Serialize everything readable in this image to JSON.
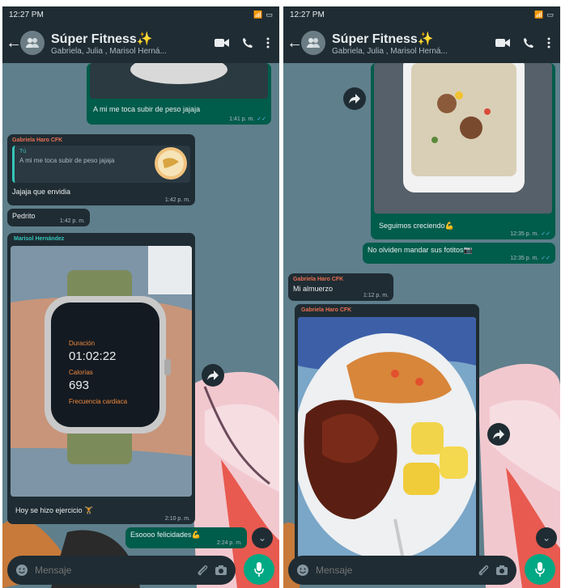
{
  "status_time": "12:27 PM",
  "chat": {
    "title": "Súper Fitness✨",
    "subtitle": "Gabriela, Julia , Marisol Herná..."
  },
  "left": {
    "msg_out_1": {
      "text": "A mi me toca subir de peso jajaja",
      "time": "1:41 p. m."
    },
    "reply_msg": {
      "sender": "Gabriela Haro CFK",
      "quoted_author": "Tú",
      "quoted_text": "A mi me toca subir de peso jajaja",
      "text": "Jajaja que envidia",
      "time": "1:42 p. m."
    },
    "msg_pedrito": {
      "text": "Pedrito",
      "time": "1:42 p. m."
    },
    "photo_msg": {
      "sender": "Marisol Hernández",
      "watch_duration_label": "Duración",
      "watch_duration": "01:02:22",
      "watch_calories_label": "Calorías",
      "watch_calories": "693",
      "watch_hr_label": "Frecuencia cardiaca",
      "caption": "Hoy se hizo ejercicio 🏋",
      "time": "2:10 p. m."
    },
    "msg_out_2": {
      "text": "Esoooo felicidades💪",
      "time": "2:24 p. m."
    }
  },
  "right": {
    "msg_out_1": {
      "text": "Seguimos creciendo💪",
      "time": "12:35 p. m."
    },
    "msg_out_2": {
      "text": "No olviden mandar sus fotitos📷",
      "time": "12:35 p. m."
    },
    "msg_in_1": {
      "sender": "Gabriela Haro CFK",
      "text": "Mi almuerzo",
      "time": "1:12 p. m."
    },
    "photo_msg": {
      "sender": "Gabriela Haro CFK"
    }
  },
  "composer": {
    "placeholder": "Mensaje"
  },
  "icons": [
    "back-arrow-icon",
    "group-avatar-icon",
    "video-call-icon",
    "phone-icon",
    "more-vert-icon",
    "forward-icon",
    "emoji-icon",
    "attach-icon",
    "camera-icon",
    "mic-icon",
    "chevron-down-icon"
  ],
  "colors": {
    "header": "#1f2c33",
    "incoming": "#1f2c33",
    "outgoing": "#005c4b",
    "accent": "#00a884",
    "read_ticks": "#53bdeb"
  }
}
